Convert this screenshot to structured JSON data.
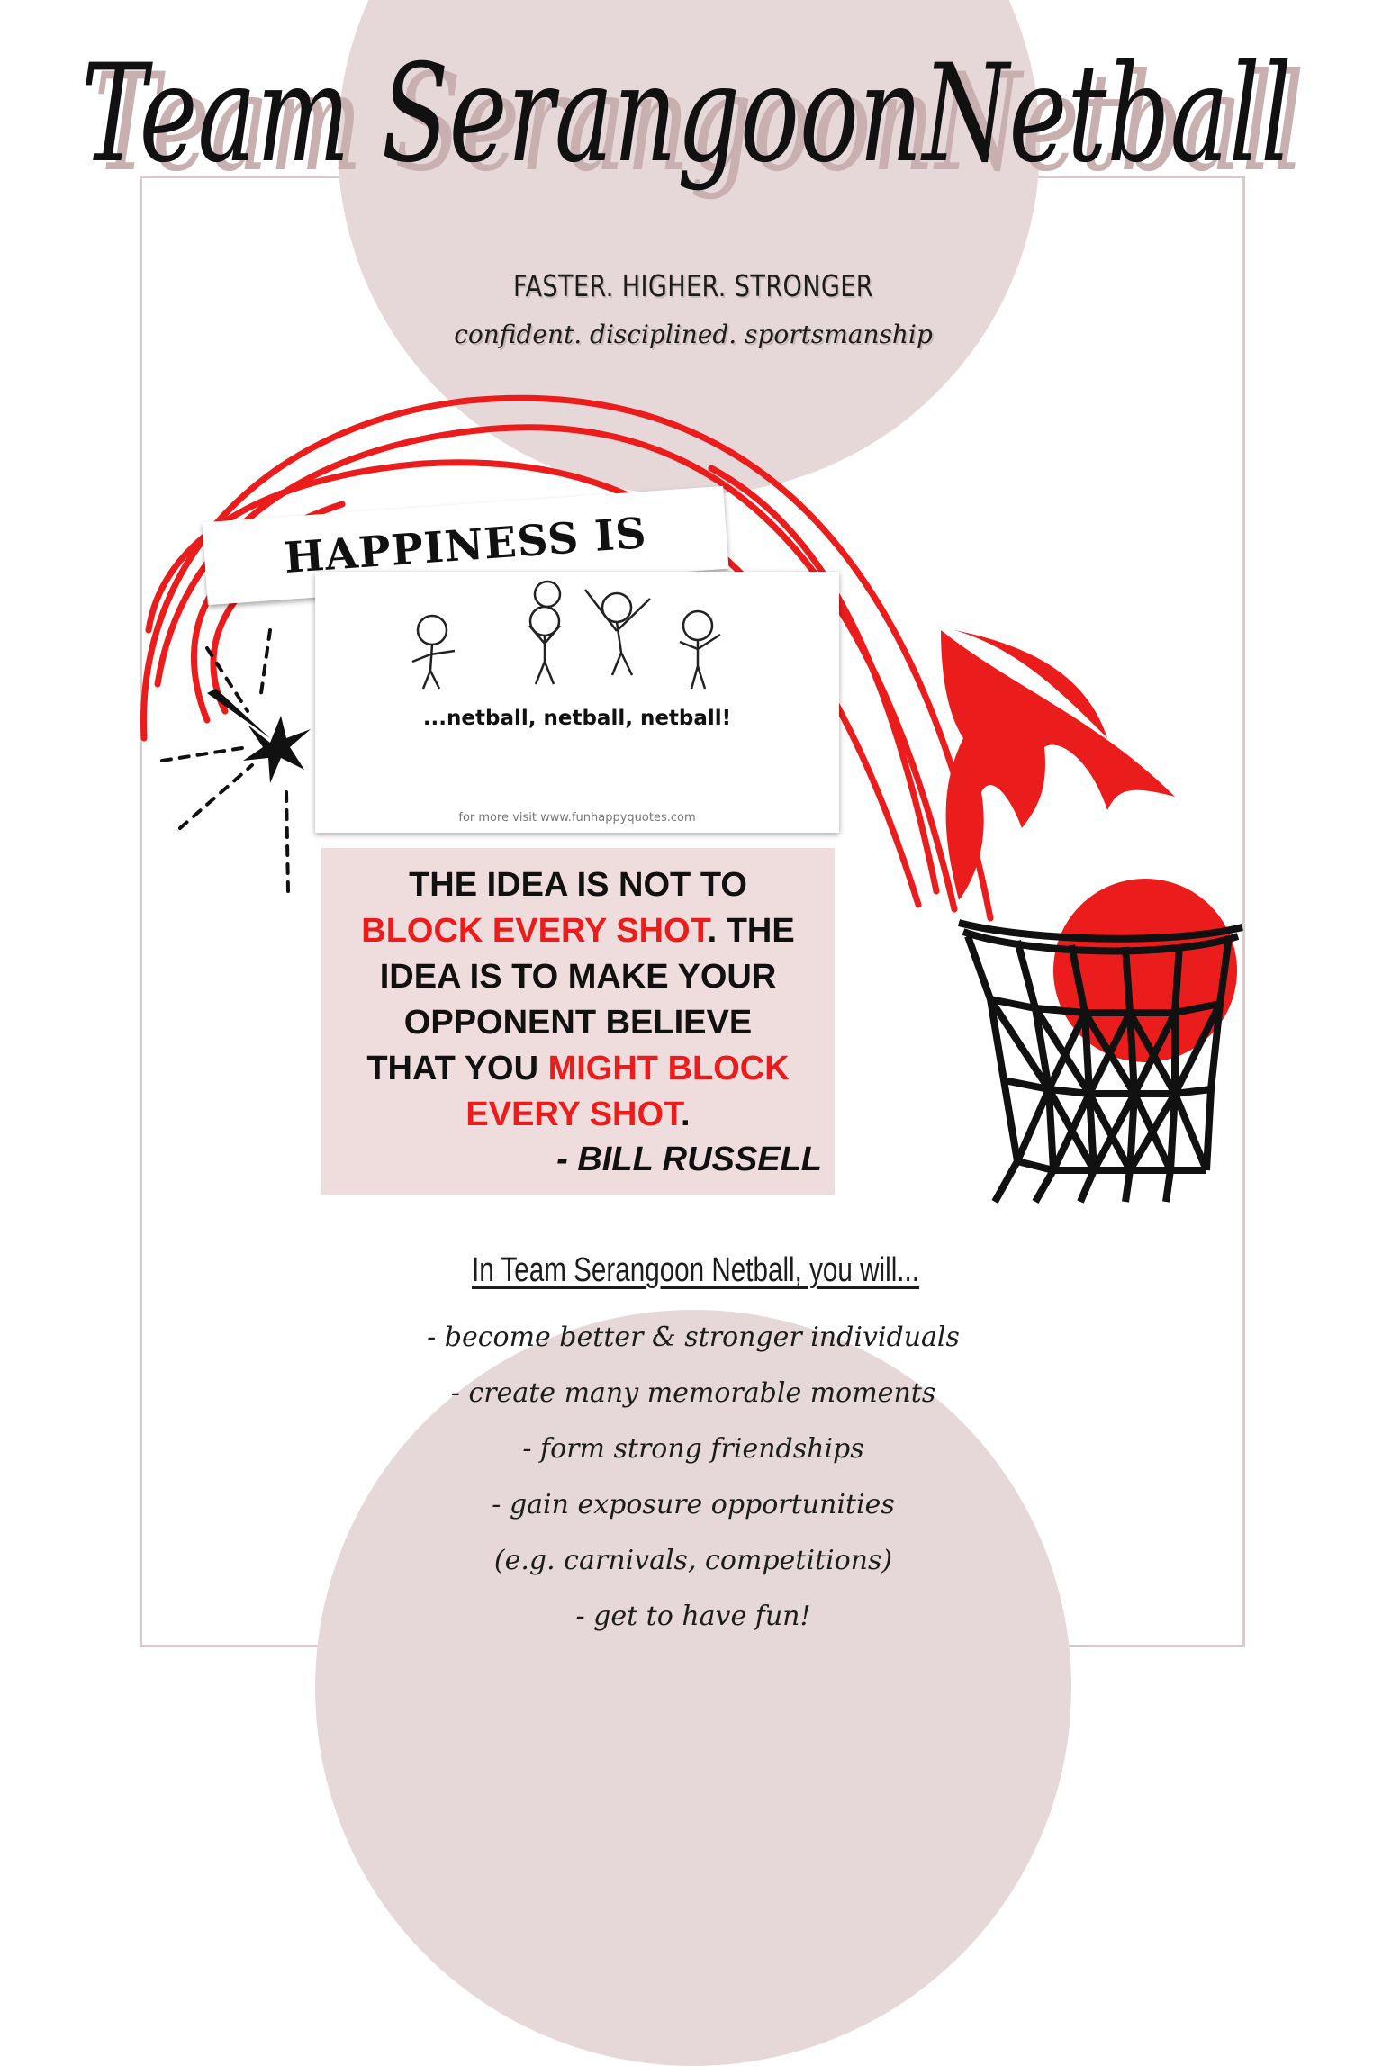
{
  "poster": {
    "title": "Team SerangoonNetball",
    "tagline": "FASTER. HIGHER. STRONGER",
    "subtagline": "confident. disciplined. sportsmanship"
  },
  "happiness_card": {
    "banner": "HAPPINESS IS",
    "caption": "...netball, netball, netball!",
    "footer": "for more visit www.funhappyquotes.com"
  },
  "quote": {
    "line1": "THE IDEA IS NOT TO",
    "line2_red": "BLOCK EVERY SHOT",
    "line2_black": ". THE",
    "line3": "IDEA IS TO MAKE YOUR",
    "line4": "OPPONENT BELIEVE",
    "line5_black": "THAT YOU ",
    "line5_red": "MIGHT BLOCK",
    "line6_red": "EVERY SHOT",
    "line6_black": ".",
    "author": "- BILL RUSSELL"
  },
  "benefits": {
    "heading": "In Team Serangoon Netball, you will...",
    "items": [
      "- become better & stronger individuals",
      "- create many memorable moments",
      "- form strong friendships",
      "- gain exposure opportunities",
      "(e.g. carnivals, competitions)",
      "- get to have fun!"
    ]
  },
  "colors": {
    "accent_red": "#ea1c1c",
    "blush": "#e6d8d8",
    "quote_bg": "#efdcdc",
    "ink": "#111111"
  }
}
